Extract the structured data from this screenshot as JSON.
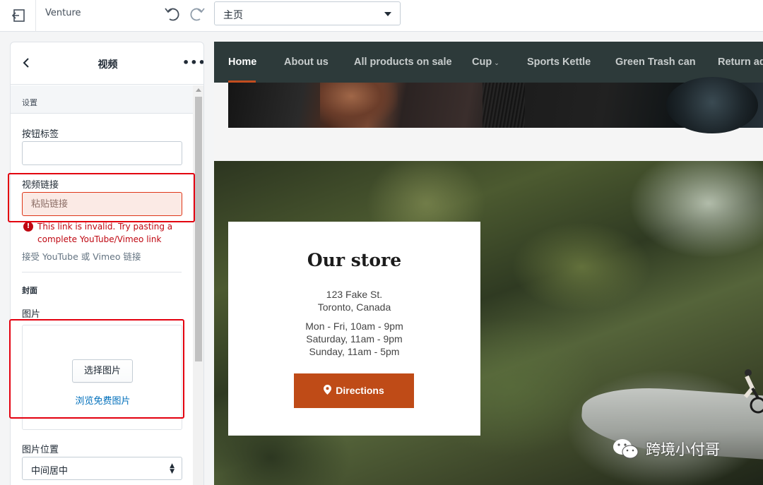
{
  "topbar": {
    "theme_name": "Venture",
    "page_selector_value": "主页"
  },
  "panel": {
    "title": "视频",
    "more_label": "•••",
    "settings_header": "设置",
    "button_label_field": {
      "label": "按钮标签",
      "value": ""
    },
    "video_link_field": {
      "label": "视频链接",
      "placeholder": "粘贴链接",
      "error": "This link is invalid. Try pasting a complete YouTube/Vimeo link",
      "help": "接受 YouTube 或 Vimeo 链接"
    },
    "cover_header": "封面",
    "image_field": {
      "label": "图片",
      "choose_button": "选择图片",
      "browse_link": "浏览免费图片"
    },
    "image_position_field": {
      "label": "图片位置",
      "value": "中间居中"
    }
  },
  "preview": {
    "nav": {
      "items": [
        {
          "label": "Home",
          "active": true
        },
        {
          "label": "About us",
          "active": false
        },
        {
          "label": "All products on sale",
          "active": false
        },
        {
          "label": "Cup",
          "active": false,
          "has_dropdown": true
        },
        {
          "label": "Sports Kettle",
          "active": false
        },
        {
          "label": "Green Trash can",
          "active": false
        },
        {
          "label": "Return add",
          "active": false
        }
      ]
    },
    "store": {
      "title": "Our store",
      "address_line1": "123 Fake St.",
      "address_line2": "Toronto, Canada",
      "hours_line1": "Mon - Fri, 10am - 9pm",
      "hours_line2": "Saturday, 11am - 9pm",
      "hours_line3": "Sunday, 11am - 5pm",
      "directions_button": "Directions",
      "button_color": "#bf4b17"
    }
  },
  "watermark": {
    "text": "跨境小付哥",
    "icon": "wechat-icon"
  },
  "colors": {
    "error_red": "#bf0711",
    "highlight_red": "#e3000f",
    "nav_bg": "#2d3a3a",
    "link_blue": "#006fbb"
  }
}
